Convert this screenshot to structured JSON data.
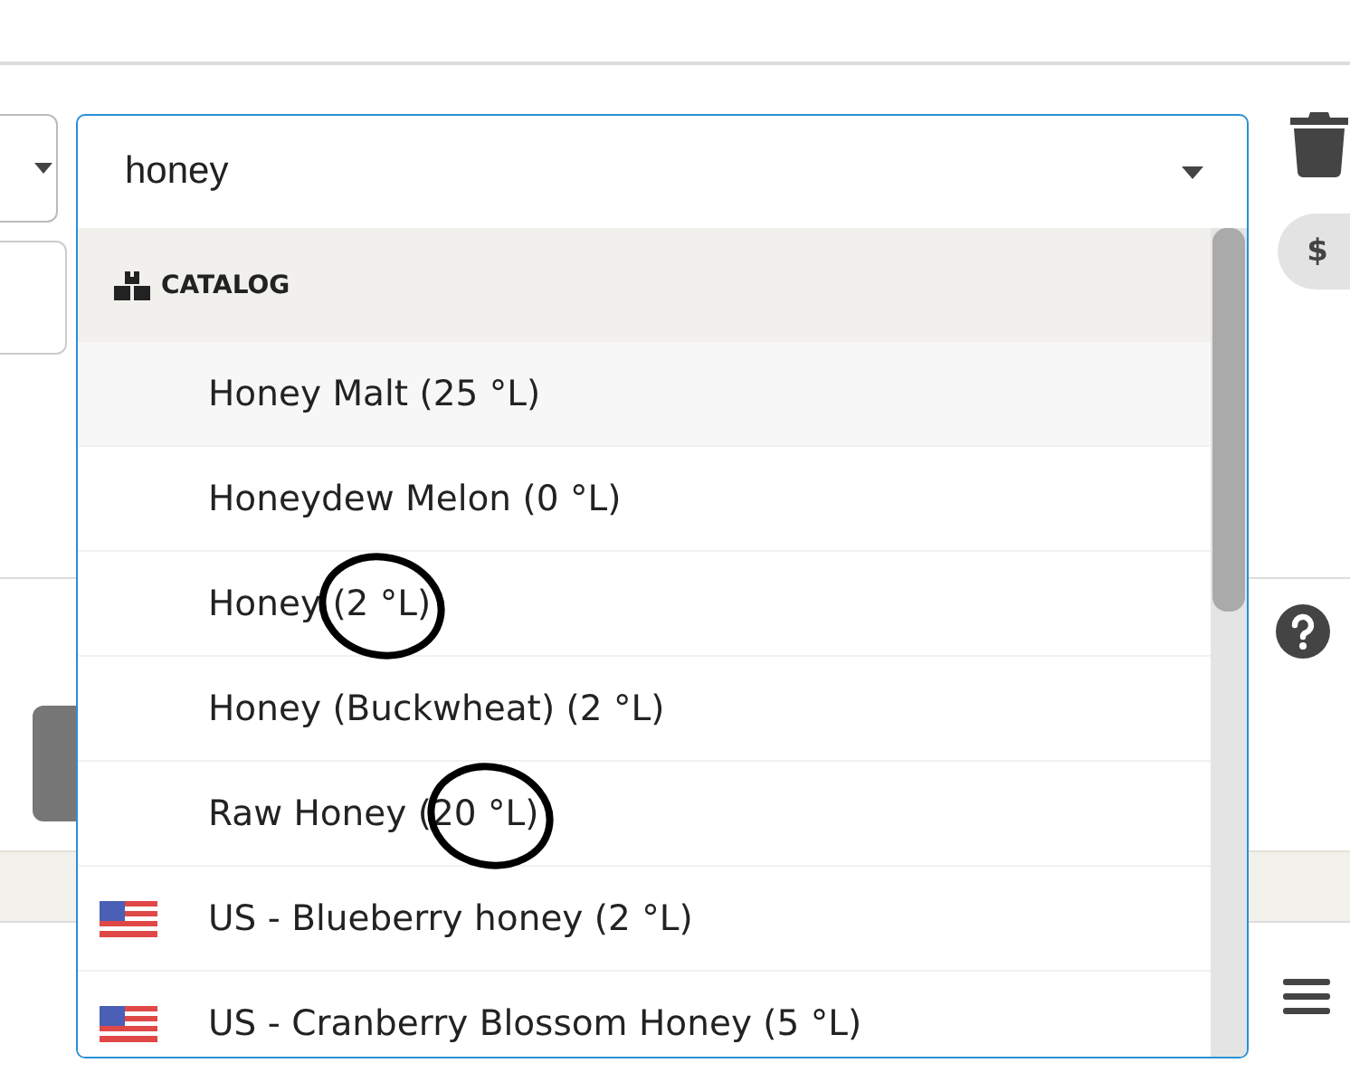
{
  "combobox": {
    "value": "honey",
    "group": "CATALOG",
    "items": [
      {
        "label": "Honey Malt (25 °L)",
        "kind": "plain",
        "selected": true,
        "circled": false
      },
      {
        "label": "Honeydew Melon (0 °L)",
        "kind": "plain",
        "selected": false,
        "circled": false
      },
      {
        "label": "Honey (2 °L)",
        "kind": "plain",
        "selected": false,
        "circled": true
      },
      {
        "label": "Honey (Buckwheat) (2 °L)",
        "kind": "plain",
        "selected": false,
        "circled": false
      },
      {
        "label": "Raw Honey (20 °L)",
        "kind": "plain",
        "selected": false,
        "circled": true
      },
      {
        "label": "US - Blueberry honey (2 °L)",
        "kind": "us-flag",
        "selected": false,
        "circled": false
      },
      {
        "label": "US - Cranberry Blossom Honey (5 °L)",
        "kind": "us-flag",
        "selected": false,
        "circled": false
      }
    ]
  },
  "price_button": "$"
}
